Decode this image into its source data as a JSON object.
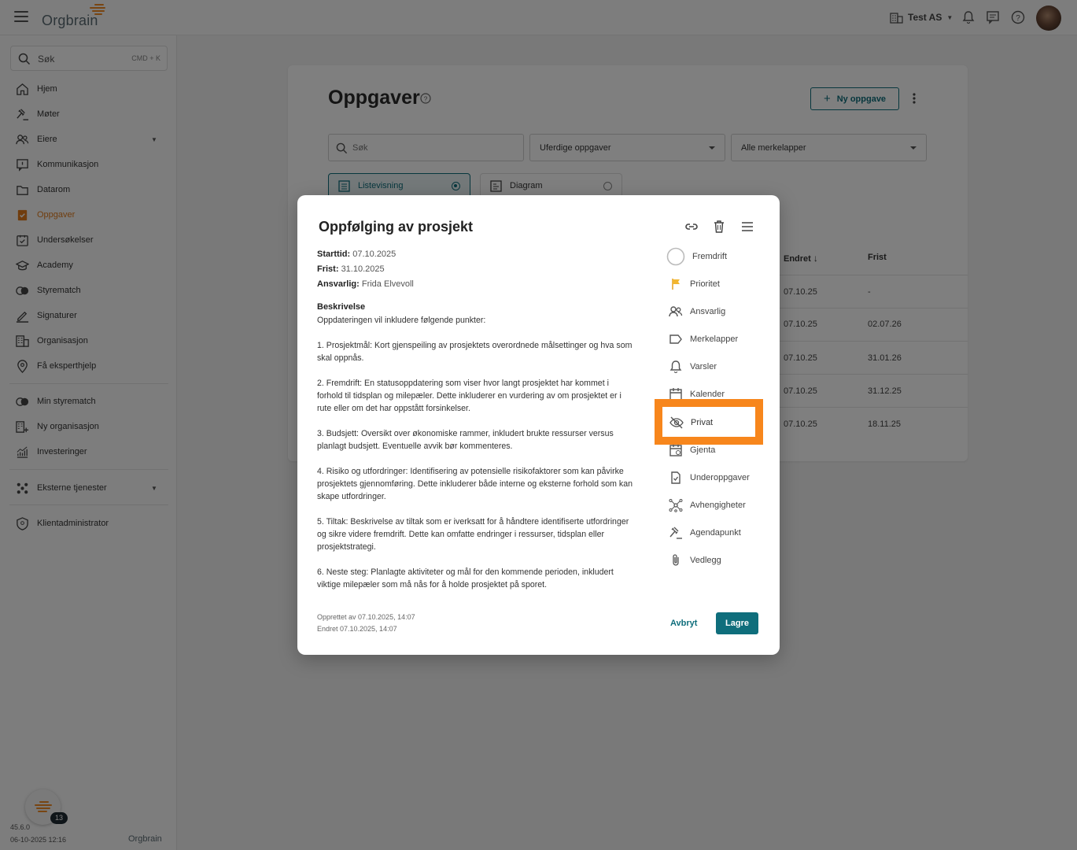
{
  "app": {
    "logo_text": "Orgbrain",
    "version": "45.6.0",
    "build_time": "06-10-2025 12:16",
    "bottom_logo": "Orgbrain",
    "notifications_count": "13"
  },
  "topbar": {
    "org_name": "Test AS"
  },
  "sidebar": {
    "search_label": "Søk",
    "search_shortcut": "CMD + K",
    "items": [
      {
        "label": "Hjem"
      },
      {
        "label": "Møter"
      },
      {
        "label": "Eiere"
      },
      {
        "label": "Kommunikasjon"
      },
      {
        "label": "Datarom"
      },
      {
        "label": "Oppgaver"
      },
      {
        "label": "Undersøkelser"
      },
      {
        "label": "Academy"
      },
      {
        "label": "Styrematch"
      },
      {
        "label": "Signaturer"
      },
      {
        "label": "Organisasjon"
      },
      {
        "label": "Få eksperthjelp"
      }
    ],
    "secondary": [
      {
        "label": "Min styrematch"
      },
      {
        "label": "Ny organisasjon"
      },
      {
        "label": "Investeringer"
      }
    ],
    "external": {
      "label": "Eksterne tjenester"
    },
    "admin": {
      "label": "Klientadministrator"
    }
  },
  "page": {
    "title": "Oppgaver",
    "new_button": "Ny oppgave",
    "search_placeholder": "Søk",
    "status_filter": "Uferdige oppgaver",
    "tag_filter": "Alle merkelapper",
    "view_list": "Listevisning",
    "view_diagram": "Diagram",
    "columns": {
      "changed": "Endret",
      "due": "Frist"
    },
    "rows": [
      {
        "changed": "07.10.25",
        "due": "-"
      },
      {
        "changed": "07.10.25",
        "due": "02.07.26"
      },
      {
        "changed": "07.10.25",
        "due": "31.01.26"
      },
      {
        "changed": "07.10.25",
        "due": "31.12.25"
      },
      {
        "changed": "07.10.25",
        "due": "18.11.25"
      }
    ]
  },
  "modal": {
    "title": "Oppfølging av prosjekt",
    "start_label": "Starttid:",
    "start_value": "07.10.2025",
    "due_label": "Frist:",
    "due_value": "31.10.2025",
    "owner_label": "Ansvarlig:",
    "owner_value": "Frida Elvevoll",
    "description_heading": "Beskrivelse",
    "description": "Oppdateringen vil inkludere følgende punkter:\n\n1. Prosjektmål: Kort gjenspeiling av prosjektets overordnede målsettinger og hva som skal oppnås.\n\n2. Fremdrift: En statusoppdatering som viser hvor langt prosjektet har kommet i forhold til tidsplan og milepæler. Dette inkluderer en vurdering av om prosjektet er i rute eller om det har oppstått forsinkelser.\n\n3. Budsjett: Oversikt over økonomiske rammer, inkludert brukte ressurser versus planlagt budsjett. Eventuelle avvik bør kommenteres.\n\n4. Risiko og utfordringer: Identifisering av potensielle risikofaktorer som kan påvirke prosjektets gjennomføring. Dette inkluderer både interne og eksterne forhold som kan skape utfordringer.\n\n5. Tiltak: Beskrivelse av tiltak som er iverksatt for å håndtere identifiserte utfordringer og sikre videre fremdrift. Dette kan omfatte endringer i ressurser, tidsplan eller prosjektstrategi.\n\n6. Neste steg: Planlagte aktiviteter og mål for den kommende perioden, inkludert viktige milepæler som må nås for å holde prosjektet på sporet.",
    "created": "Opprettet av 07.10.2025, 14:07",
    "changed": "Endret 07.10.2025, 14:07",
    "cancel": "Avbryt",
    "save": "Lagre",
    "side_items": [
      {
        "label": "Fremdrift",
        "icon": "progress-ring-icon"
      },
      {
        "label": "Prioritet",
        "icon": "flag-icon"
      },
      {
        "label": "Ansvarlig",
        "icon": "people-icon"
      },
      {
        "label": "Merkelapper",
        "icon": "tag-icon"
      },
      {
        "label": "Varsler",
        "icon": "bell-icon"
      },
      {
        "label": "Kalender",
        "icon": "calendar-icon"
      },
      {
        "label": "Privat",
        "icon": "eye-off-icon"
      },
      {
        "label": "Gjenta",
        "icon": "repeat-calendar-icon"
      },
      {
        "label": "Underoppgaver",
        "icon": "subtask-icon"
      },
      {
        "label": "Avhengigheter",
        "icon": "dependency-icon"
      },
      {
        "label": "Agendapunkt",
        "icon": "gavel-icon"
      },
      {
        "label": "Vedlegg",
        "icon": "paperclip-icon"
      }
    ]
  },
  "colors": {
    "accent": "#0f6e7c",
    "active_nav": "#e07b1d",
    "highlight": "#f7861c"
  }
}
